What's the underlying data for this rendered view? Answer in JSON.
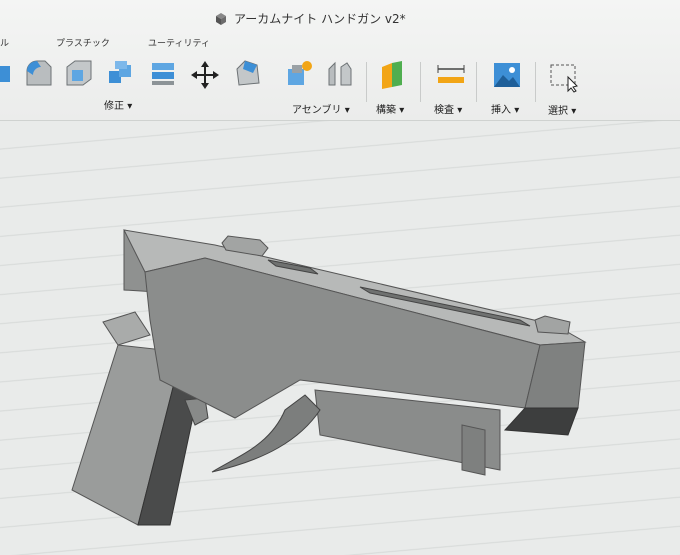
{
  "app": {
    "document_title": "アーカムナイト ハンドガン v2*"
  },
  "toolbar": {
    "left_cut_label": "ル",
    "group_plastic": "プラスチック",
    "group_utility": "ユーティリティ",
    "menus": {
      "modify": "修正",
      "assemble": "アセンブリ",
      "construct": "構築",
      "inspect": "検査",
      "insert": "挿入",
      "select": "選択"
    },
    "dropdown_arrow": "▾",
    "accent_blue": "#3d8fd6"
  },
  "viewport": {
    "model_color": "#8e908f"
  }
}
